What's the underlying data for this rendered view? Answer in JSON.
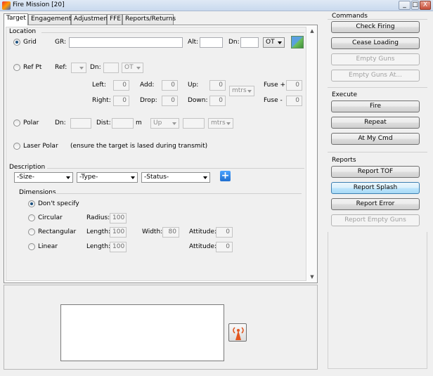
{
  "window": {
    "title": "Fire Mission [20]",
    "controls": [
      "_",
      "□",
      "X"
    ]
  },
  "tabs": [
    "Target",
    "Engagement",
    "Adjustment",
    "FFE",
    "Reports/Returns"
  ],
  "location": {
    "heading": "Location",
    "grid": {
      "label": "Grid",
      "gr_label": "GR:",
      "gr_value": "",
      "alt_label": "Alt:",
      "alt_value": "",
      "dn_label": "Dn:",
      "dn_value": "",
      "mode": "OT"
    },
    "ref_pt": {
      "label": "Ref Pt",
      "ref_label": "Ref:",
      "ref_value": "",
      "dn_label": "Dn:",
      "dn_value": "",
      "mode": "OT",
      "left_label": "Left:",
      "left_value": "0",
      "add_label": "Add:",
      "add_value": "0",
      "up_label": "Up:",
      "up_value": "0",
      "fuse_plus_label": "Fuse +",
      "fuse_plus_value": "0",
      "right_label": "Right:",
      "right_value": "0",
      "drop_label": "Drop:",
      "drop_value": "0",
      "down_label": "Down:",
      "down_value": "0",
      "fuse_minus_label": "Fuse -",
      "fuse_minus_value": "0",
      "units": "mtrs"
    },
    "polar": {
      "label": "Polar",
      "dn_label": "Dn:",
      "dist_label": "Dist:",
      "dist_unit": "m",
      "dir": "Up",
      "units": "mtrs"
    },
    "laser": {
      "label": "Laser Polar",
      "note": "(ensure the target is lased during transmit)"
    }
  },
  "description": {
    "heading": "Description",
    "size": "-Size-",
    "type": "-Type-",
    "status": "-Status-",
    "dimensions": {
      "heading": "Dimensions",
      "dont_specify": "Don't specify",
      "circular": "Circular",
      "radius_label": "Radius:",
      "radius_value": "100",
      "rectangular": "Rectangular",
      "length_label": "Length:",
      "rect_length_value": "100",
      "width_label": "Width:",
      "width_value": "80",
      "attitude_label": "Attitude:",
      "rect_attitude_value": "0",
      "linear": "Linear",
      "lin_length_value": "100",
      "lin_attitude_value": "0"
    }
  },
  "commands": {
    "heading": "Commands",
    "check_firing": "Check Firing",
    "cease_loading": "Cease Loading",
    "empty_guns": "Empty Guns",
    "empty_guns_at": "Empty Guns At..."
  },
  "execute": {
    "heading": "Execute",
    "fire": "Fire",
    "repeat": "Repeat",
    "at_my_cmd": "At My Cmd"
  },
  "reports": {
    "heading": "Reports",
    "report_tof": "Report TOF",
    "report_splash": "Report Splash",
    "report_error": "Report Error",
    "report_empty_guns": "Report Empty Guns"
  },
  "colors": {
    "hot_button": "#bee6fd",
    "active_tab": "#ffffff",
    "title_bar": "#c9d9ee"
  }
}
